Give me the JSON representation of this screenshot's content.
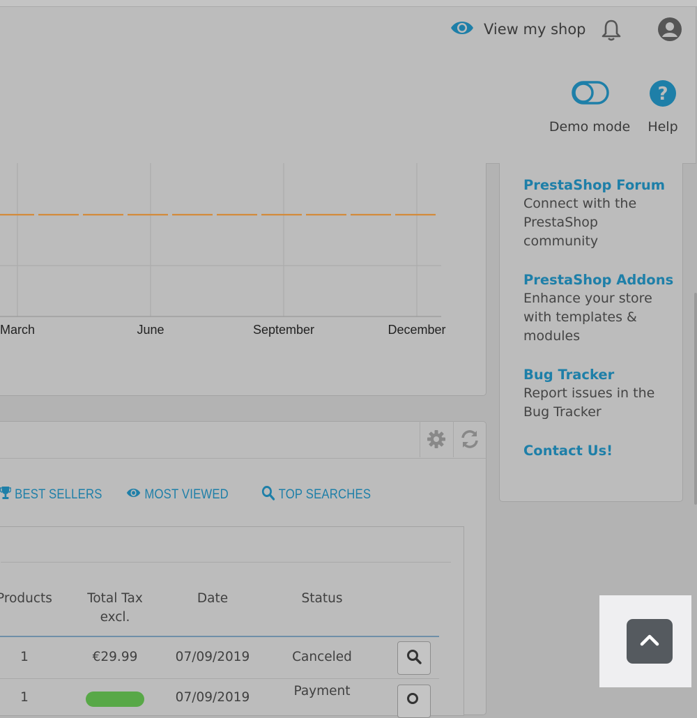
{
  "header": {
    "view_shop_label": "View my shop",
    "demo_mode_label": "Demo mode",
    "help_label": "Help"
  },
  "chart_data": {
    "type": "line",
    "categories": [
      "March",
      "June",
      "September",
      "December"
    ],
    "series": [
      {
        "values": [
          0,
          0,
          0,
          0
        ],
        "color": "#d38a3a",
        "style": "dashed"
      }
    ],
    "grid": true
  },
  "help_links": [
    {
      "title": "PrestaShop Forum",
      "description": "Connect with the PrestaShop community"
    },
    {
      "title": "PrestaShop Addons",
      "description": "Enhance your store with templates & modules"
    },
    {
      "title": "Bug Tracker",
      "description": "Report issues in the Bug Tracker"
    },
    {
      "title": "Contact Us!",
      "description": ""
    }
  ],
  "orders_panel": {
    "tabs": [
      {
        "label": "BEST SELLERS",
        "icon": "trophy-icon"
      },
      {
        "label": "MOST VIEWED",
        "icon": "eye-icon"
      },
      {
        "label": "TOP SEARCHES",
        "icon": "search-icon"
      }
    ],
    "columns": [
      "Products",
      "Total Tax excl.",
      "Date",
      "Status"
    ],
    "rows": [
      {
        "products": "1",
        "total": "€29.99",
        "date": "07/09/2019",
        "status": "Canceled"
      },
      {
        "products": "1",
        "total": "",
        "date": "07/09/2019",
        "status": "Payment"
      }
    ]
  },
  "colors": {
    "accent": "#1e7fa8",
    "chart_line": "#d38a3a",
    "badge_green": "#58a847"
  }
}
